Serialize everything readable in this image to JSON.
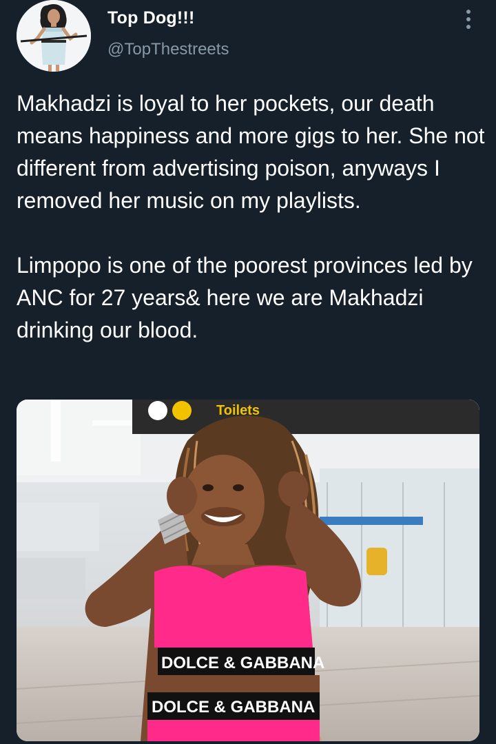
{
  "user": {
    "display_name": "Top Dog!!!",
    "handle": "@TopThestreets",
    "avatar_icon": "avatar-woman-icon"
  },
  "menu": {
    "icon": "more-vertical-icon"
  },
  "tweet": {
    "paragraphs": [
      "Makhadzi is loyal to her pockets, our death means happiness and more gigs to her. She not different from advertising poison, anyways I removed her music on my playlists.",
      "Limpopo is one of the poorest provinces led by ANC for 27 years& here we are Makhadzi drinking our blood."
    ]
  },
  "media": {
    "sign_text": "Toilets",
    "top_logo_text": "DOLCE & GABBANA",
    "bottom_logo_text": "DOLCE & GABBANA"
  },
  "colors": {
    "background": "#15202b",
    "secondary_text": "#8899a6",
    "top_color": "#ff2a8a"
  }
}
